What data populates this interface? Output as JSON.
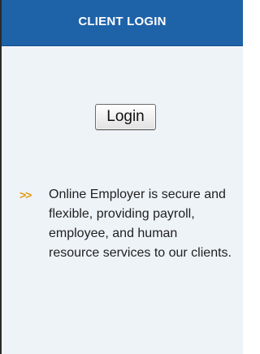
{
  "header": {
    "title": "CLIENT LOGIN"
  },
  "login": {
    "button_label": "Login"
  },
  "description": {
    "marker": ">>",
    "text": "Online Employer is secure and flexible, providing payroll, employee, and human resource services to our clients."
  },
  "colors": {
    "header_bg": "#1e62a8",
    "panel_bg": "#eef3f8",
    "marker": "#e39a12"
  }
}
